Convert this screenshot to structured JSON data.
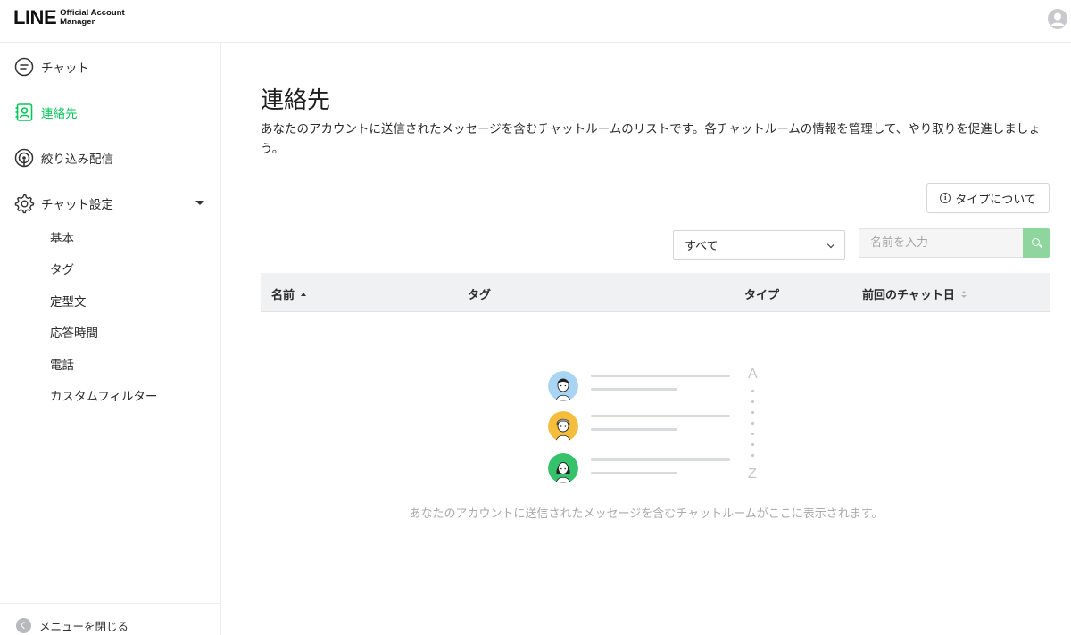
{
  "header": {
    "logo_main": "LINE",
    "logo_sub_line1": "Official Account",
    "logo_sub_line2": "Manager"
  },
  "sidebar": {
    "items": [
      {
        "label": "チャット",
        "icon": "chat-icon",
        "active": false
      },
      {
        "label": "連絡先",
        "icon": "contacts-icon",
        "active": true
      },
      {
        "label": "絞り込み配信",
        "icon": "broadcast-icon",
        "active": false
      },
      {
        "label": "チャット設定",
        "icon": "gear-icon",
        "active": false
      }
    ],
    "sub_items": [
      "基本",
      "タグ",
      "定型文",
      "応答時間",
      "電話",
      "カスタムフィルター"
    ],
    "close_menu_label": "メニューを閉じる",
    "accent_color": "#06c755"
  },
  "main": {
    "title": "連絡先",
    "description": "あなたのアカウントに送信されたメッセージを含むチャットルームのリストです。各チャットルームの情報を管理して、やり取りを促進しましょう。",
    "type_button_label": "タイプについて",
    "filter_select_value": "すべて",
    "search_placeholder": "名前を入力",
    "search_button_color": "#8ed69d",
    "table": {
      "columns": [
        "名前",
        "タグ",
        "タイプ",
        "前回のチャット日"
      ]
    },
    "empty": {
      "letter_top": "A",
      "letter_bottom": "Z",
      "message": "あなたのアカウントに送信されたメッセージを含むチャットルームがここに表示されます。"
    }
  }
}
